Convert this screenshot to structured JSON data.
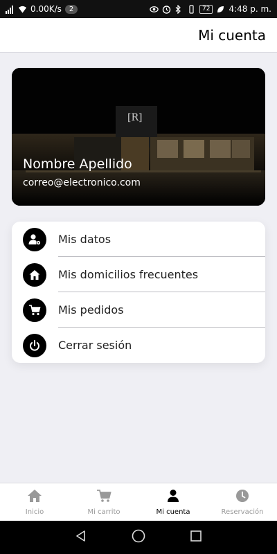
{
  "status_bar": {
    "speed": "0.00K/s",
    "notification_count": "2",
    "battery": "72",
    "time": "4:48 p. m."
  },
  "header": {
    "title": "Mi cuenta"
  },
  "profile": {
    "name": "Nombre Apellido",
    "email": "correo@electronico.com"
  },
  "menu": {
    "items": [
      {
        "label": "Mis datos",
        "icon": "user-gear-icon"
      },
      {
        "label": "Mis domicilios frecuentes",
        "icon": "home-icon"
      },
      {
        "label": "Mis pedidos",
        "icon": "cart-icon"
      },
      {
        "label": "Cerrar sesión",
        "icon": "power-icon"
      }
    ]
  },
  "tabs": [
    {
      "label": "Inicio",
      "icon": "home-icon",
      "active": false
    },
    {
      "label": "Mi carrito",
      "icon": "cart-icon",
      "active": false
    },
    {
      "label": "Mi cuenta",
      "icon": "user-icon",
      "active": true
    },
    {
      "label": "Reservación",
      "icon": "clock-icon",
      "active": false
    }
  ],
  "colors": {
    "background": "#efeff4",
    "icon_fill": "#000000",
    "inactive_tab": "#999999",
    "active_tab": "#000000"
  }
}
